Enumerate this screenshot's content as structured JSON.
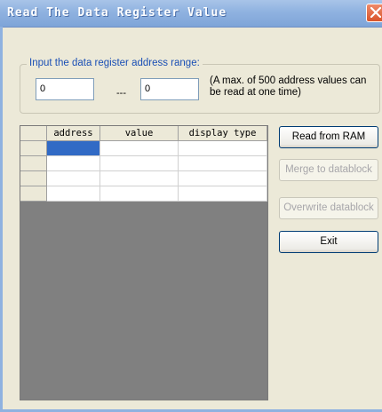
{
  "window": {
    "title": "Read The Data Register Value",
    "close_icon": "close-icon"
  },
  "range": {
    "legend": "Input the data register address range:",
    "start_value": "0",
    "separator": "---",
    "end_value": "0",
    "note": "(A max. of 500 address values can be read at one time)"
  },
  "grid": {
    "columns": [
      "address",
      "value",
      "display type"
    ],
    "rows": [
      [
        "",
        "",
        ""
      ],
      [
        "",
        "",
        ""
      ],
      [
        "",
        "",
        ""
      ],
      [
        "",
        "",
        ""
      ]
    ]
  },
  "buttons": {
    "read": "Read from RAM",
    "merge": "Merge to datablock",
    "overwrite": "Overwrite datablock",
    "exit": "Exit"
  },
  "colors": {
    "title_gradient": "#8fb2e0",
    "selection": "#316ac5",
    "legend_text": "#1a4fb5"
  }
}
